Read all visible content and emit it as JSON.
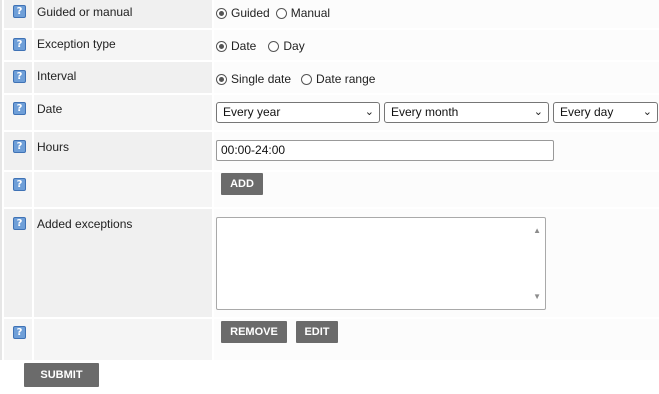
{
  "help_glyph": "?",
  "rows": {
    "guided": {
      "label": "Guided or manual",
      "options": [
        "Guided",
        "Manual"
      ],
      "selected": "Guided"
    },
    "exception_type": {
      "label": "Exception type",
      "options": [
        "Date",
        "Day"
      ],
      "selected": "Date"
    },
    "interval": {
      "label": "Interval",
      "options": [
        "Single date",
        "Date range"
      ],
      "selected": "Single date"
    },
    "date": {
      "label": "Date",
      "year": "Every year",
      "month": "Every month",
      "day": "Every day"
    },
    "hours": {
      "label": "Hours",
      "value": "00:00-24:00"
    },
    "add": {
      "button": "ADD"
    },
    "added_exceptions": {
      "label": "Added exceptions",
      "items": []
    },
    "actions": {
      "remove": "REMOVE",
      "edit": "EDIT"
    }
  },
  "submit": "SUBMIT",
  "chevron_icon": "chevron-down-icon",
  "colors": {
    "button_bg": "#6b6b6b",
    "help_icon": "#6f9fd8"
  }
}
